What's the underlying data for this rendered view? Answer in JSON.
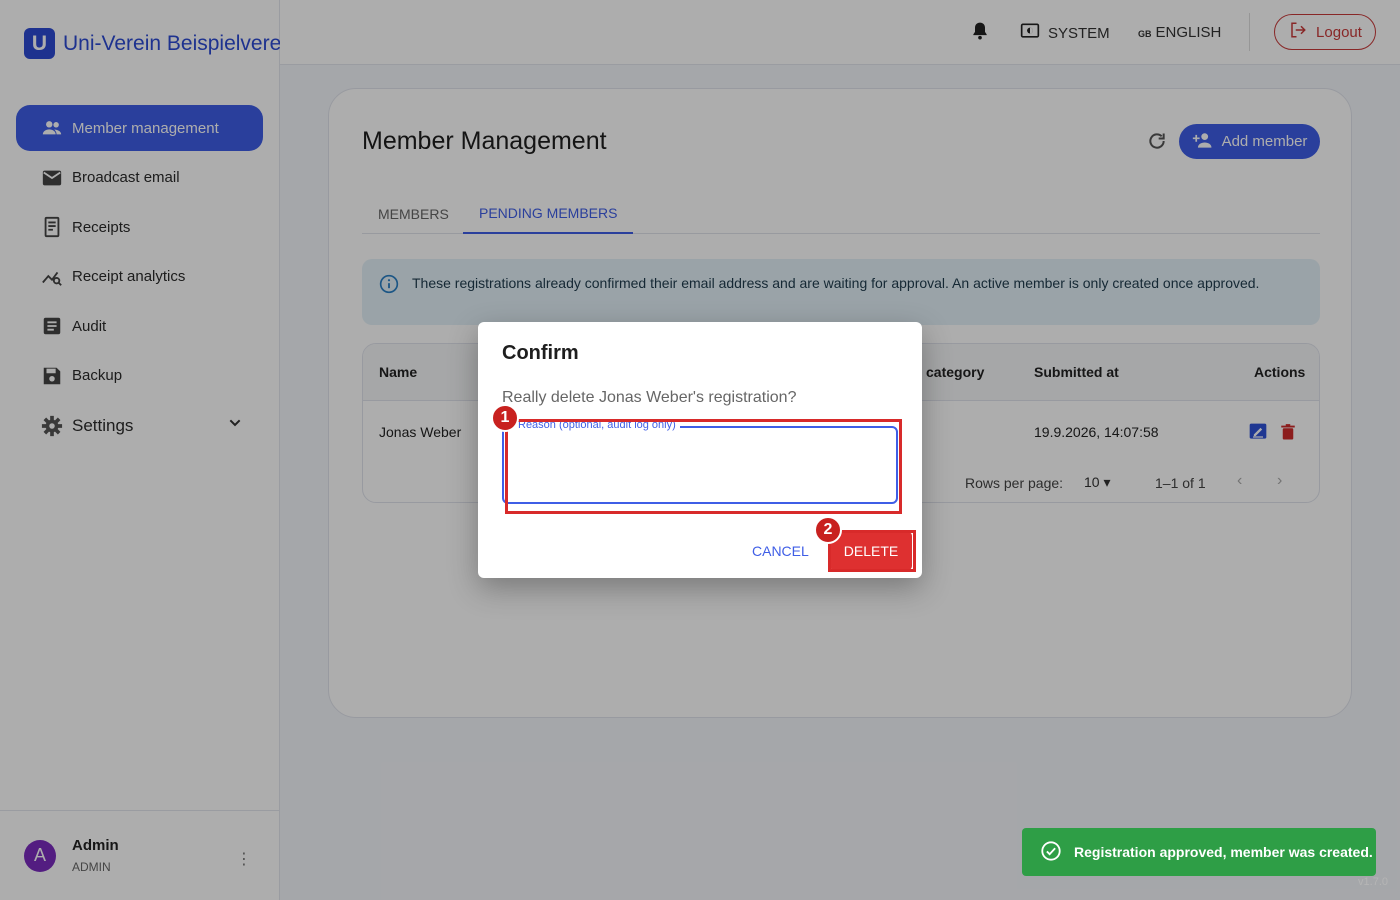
{
  "brand": {
    "letter": "U",
    "name": "Uni-Verein Beispielverein"
  },
  "nav": {
    "items": [
      {
        "label": "Member management",
        "icon": "users-icon",
        "active": true
      },
      {
        "label": "Broadcast email",
        "icon": "mail-icon"
      },
      {
        "label": "Receipts",
        "icon": "receipt-icon"
      },
      {
        "label": "Receipt analytics",
        "icon": "analytics-icon"
      },
      {
        "label": "Audit",
        "icon": "list-icon"
      },
      {
        "label": "Backup",
        "icon": "save-icon"
      }
    ],
    "settings_label": "Settings"
  },
  "user": {
    "initial": "A",
    "name": "Admin",
    "role": "ADMIN"
  },
  "topbar": {
    "theme_label": "SYSTEM",
    "lang_flag": "GB",
    "lang_label": "ENGLISH",
    "logout_label": "Logout"
  },
  "page": {
    "title": "Member Management",
    "add_label": "Add member",
    "tabs": [
      "MEMBERS",
      "PENDING MEMBERS"
    ],
    "info": "These registrations already confirmed their email address and are waiting for approval. An active member is only created once approved."
  },
  "table": {
    "headers": [
      "Name",
      "category",
      "Submitted at",
      "Actions"
    ],
    "rows": [
      {
        "name": "Jonas Weber",
        "submitted": "19.9.2026, 14:07:58"
      }
    ],
    "rows_per_page_label": "Rows per page:",
    "rows_per_page": "10",
    "range": "1–1 of 1"
  },
  "dialog": {
    "title": "Confirm",
    "message": "Really delete Jonas Weber's registration?",
    "field_label": "Reason (optional, audit log only)",
    "field_value": "",
    "cancel_label": "CANCEL",
    "delete_label": "DELETE"
  },
  "annotations": {
    "badge1": "1",
    "badge2": "2"
  },
  "toast": {
    "message": "Registration approved, member was created."
  },
  "version": "v1.7.0",
  "colors": {
    "primary": "#3f5ee6",
    "danger": "#de3030",
    "success": "#2e9e46",
    "highlight": "#d82a2a"
  }
}
